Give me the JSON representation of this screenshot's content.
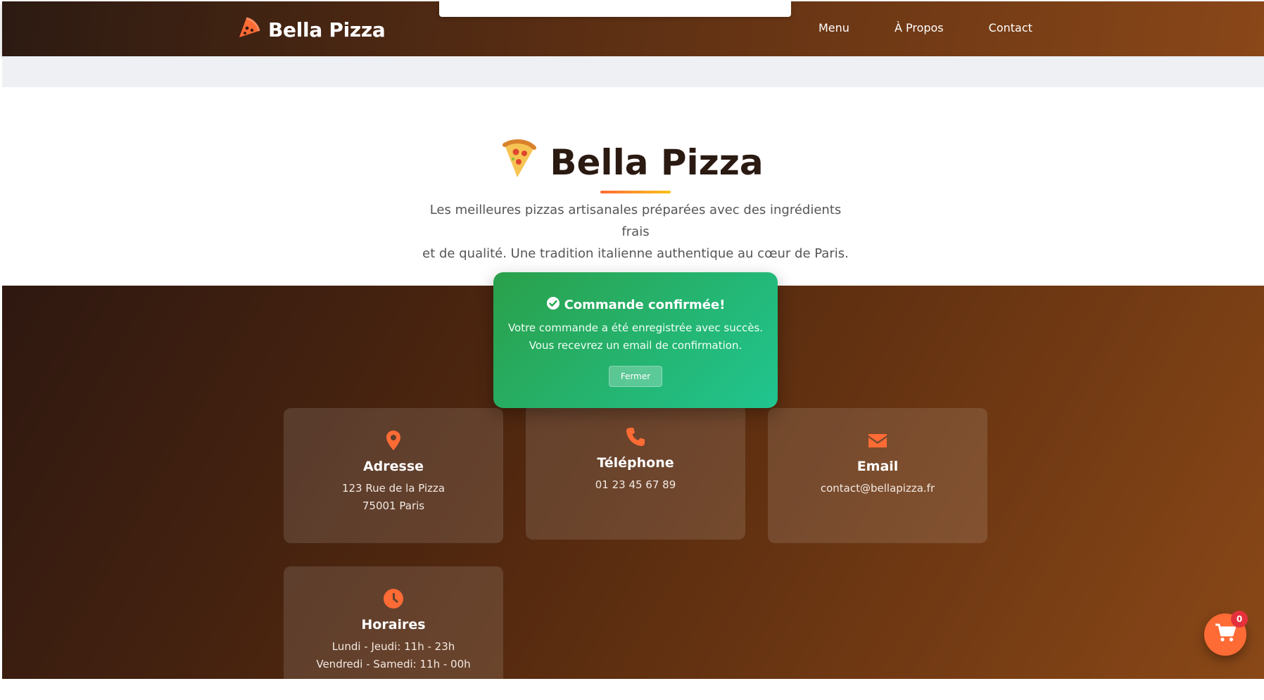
{
  "header": {
    "brand_name": "Bella Pizza",
    "brand_icon": "pizza-slice-icon",
    "nav": [
      "Menu",
      "À Propos",
      "Contact"
    ]
  },
  "hero": {
    "title": "Bella Pizza",
    "title_icon": "pizza-emoji-icon",
    "description_line1": "Les meilleures pizzas artisanales préparées avec des ingrédients frais",
    "description_line2": "et de qualité. Une tradition italienne authentique au cœur de Paris."
  },
  "contact": {
    "address": {
      "title": "Adresse",
      "line1": "123 Rue de la Pizza",
      "line2": "75001 Paris",
      "icon": "map-pin-icon"
    },
    "phone": {
      "title": "Téléphone",
      "value": "01 23 45 67 89",
      "icon": "phone-icon"
    },
    "email": {
      "title": "Email",
      "value": "contact@bellapizza.fr",
      "icon": "envelope-icon"
    },
    "hours": {
      "title": "Horaires",
      "line1": "Lundi - Jeudi: 11h - 23h",
      "line2": "Vendredi - Samedi: 11h - 00h",
      "icon": "clock-icon"
    }
  },
  "toast": {
    "title": "Commande confirmée!",
    "line1": "Votre commande a été enregistrée avec succès.",
    "line2": "Vous recevrez un email de confirmation.",
    "button": "Fermer",
    "icon": "check-circle-icon"
  },
  "cart": {
    "count": "0",
    "icon": "shopping-cart-icon"
  },
  "colors": {
    "accent": "#ff6b35",
    "header_dark": "#2c1a12",
    "header_light": "#8a4718",
    "toast_green": "#2aa04a",
    "toast_teal": "#20c590",
    "badge_red": "#e5313c"
  }
}
